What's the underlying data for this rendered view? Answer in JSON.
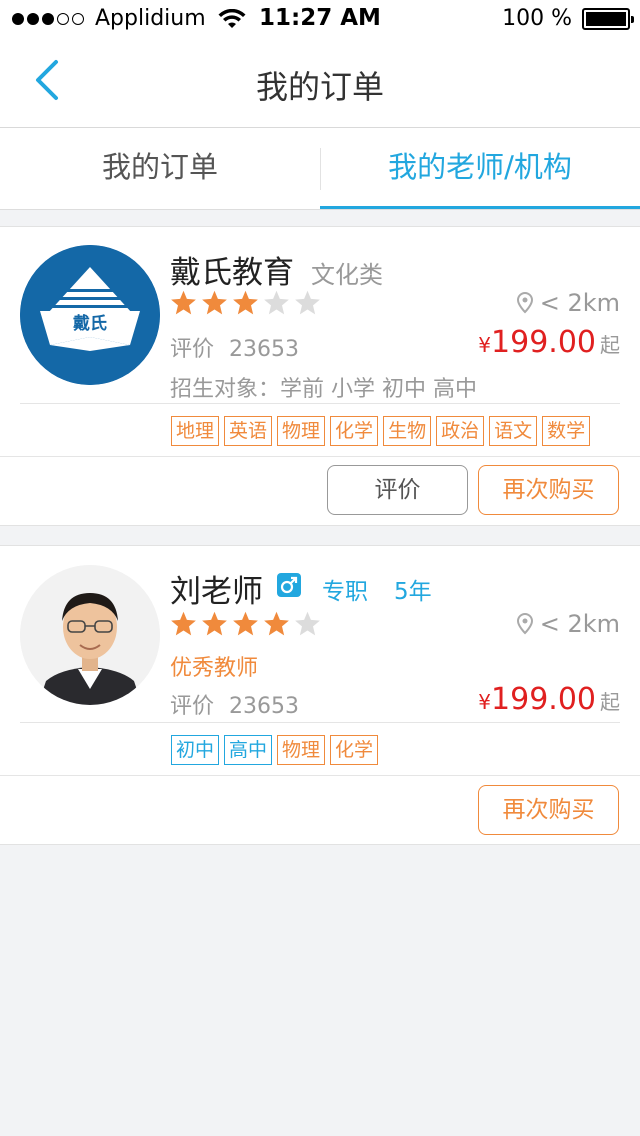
{
  "status_bar": {
    "carrier": "Applidium",
    "time": "11:27 AM",
    "battery": "100 %"
  },
  "nav": {
    "title": "我的订单"
  },
  "tabs": [
    {
      "label": "我的订单",
      "active": false
    },
    {
      "label": "我的老师/机构",
      "active": true
    }
  ],
  "colors": {
    "accent": "#22a7df",
    "orange": "#f08a3c",
    "price_red": "#e02020"
  },
  "cards": [
    {
      "name": "戴氏教育",
      "category": "文化类",
      "stars": 3,
      "max_stars": 5,
      "distance": "< 2km",
      "rating_label": "评价",
      "rating_count": "23653",
      "price_symbol": "¥",
      "price": "199.00",
      "price_suffix": "起",
      "enroll": "招生对象：学前 小学 初中 高中",
      "logo_text": "戴氏",
      "tags": [
        "地理",
        "英语",
        "物理",
        "化学",
        "生物",
        "政治",
        "语文",
        "数学"
      ],
      "buttons": {
        "rate": "评价",
        "buy": "再次购买"
      }
    },
    {
      "name": "刘老师",
      "gender_icon": "male-icon",
      "gender_symbol": "♂",
      "role": "专职",
      "years": "5年",
      "stars": 4,
      "max_stars": 5,
      "distance": "< 2km",
      "honor": "优秀教师",
      "rating_label": "评价",
      "rating_count": "23653",
      "price_symbol": "¥",
      "price": "199.00",
      "price_suffix": "起",
      "tags_blue": [
        "初中",
        "高中"
      ],
      "tags": [
        "物理",
        "化学"
      ],
      "buttons": {
        "buy": "再次购买"
      }
    }
  ]
}
